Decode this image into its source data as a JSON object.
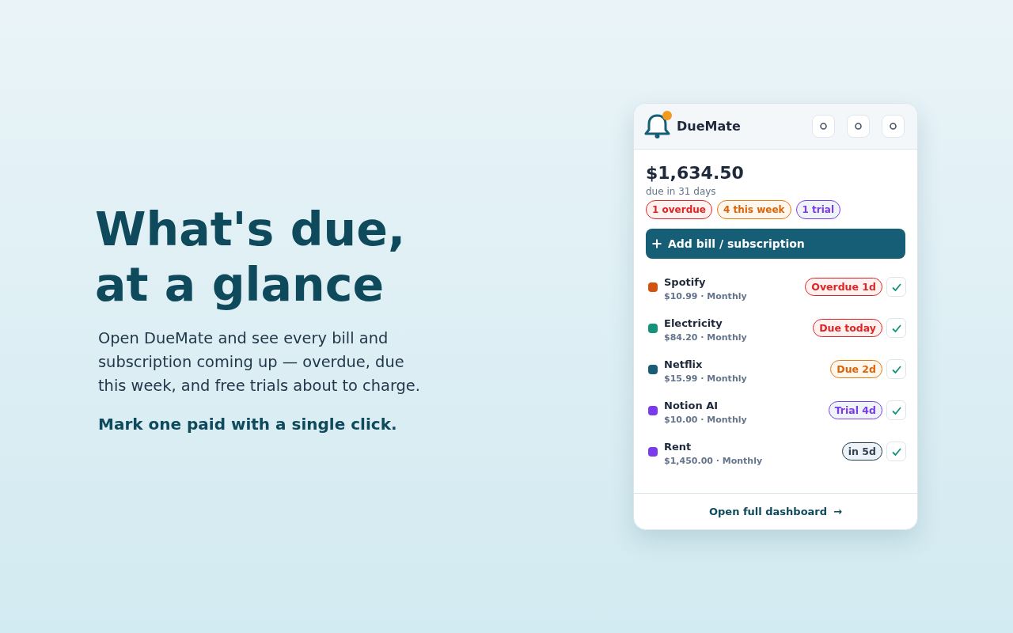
{
  "hero": {
    "title_lines": [
      "What's due,",
      "at a glance"
    ],
    "description": "Open DueMate and see every bill and subscription coming up — overdue, due this week, and free trials about to charge.",
    "tagline": "Mark one paid with a single click."
  },
  "widget": {
    "app_name": "DueMate",
    "has_notification": true,
    "total": "$1,634.50",
    "total_caption": "due in 31 days",
    "summary_pills": [
      {
        "label": "1 overdue",
        "kind": "overdue"
      },
      {
        "label": "4 this week",
        "kind": "soon"
      },
      {
        "label": "1 trial",
        "kind": "trial"
      }
    ],
    "add_button": "Add bill / subscription",
    "bills": [
      {
        "name": "Spotify",
        "detail": "$10.99 · Monthly",
        "color": "#d4520f",
        "status": {
          "label": "Overdue 1d",
          "kind": "overdue"
        }
      },
      {
        "name": "Electricity",
        "detail": "$84.20 · Monthly",
        "color": "#14937a",
        "status": {
          "label": "Due today",
          "kind": "overdue"
        }
      },
      {
        "name": "Netflix",
        "detail": "$15.99 · Monthly",
        "color": "#165e75",
        "status": {
          "label": "Due 2d",
          "kind": "soon"
        }
      },
      {
        "name": "Notion AI",
        "detail": "$10.00 · Monthly",
        "color": "#7c3aed",
        "status": {
          "label": "Trial 4d",
          "kind": "trial"
        }
      },
      {
        "name": "Rent",
        "detail": "$1,450.00 · Monthly",
        "color": "#7c3aed",
        "status": {
          "label": "in 5d",
          "kind": "upcoming"
        }
      }
    ],
    "footer_link": "Open full dashboard",
    "footer_arrow": "→"
  }
}
